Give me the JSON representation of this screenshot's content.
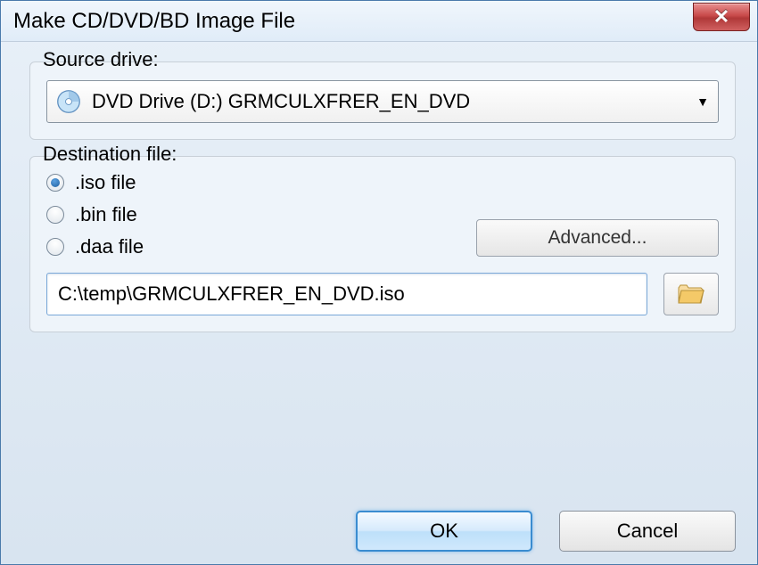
{
  "window": {
    "title": "Make CD/DVD/BD Image File"
  },
  "source": {
    "legend": "Source drive:",
    "selected": "DVD Drive (D:) GRMCULXFRER_EN_DVD"
  },
  "destination": {
    "legend": "Destination file:",
    "options": {
      "iso": ".iso file",
      "bin": ".bin file",
      "daa": ".daa file"
    },
    "selected": "iso",
    "advanced_label": "Advanced...",
    "path": "C:\\temp\\GRMCULXFRER_EN_DVD.iso"
  },
  "buttons": {
    "ok": "OK",
    "cancel": "Cancel"
  }
}
